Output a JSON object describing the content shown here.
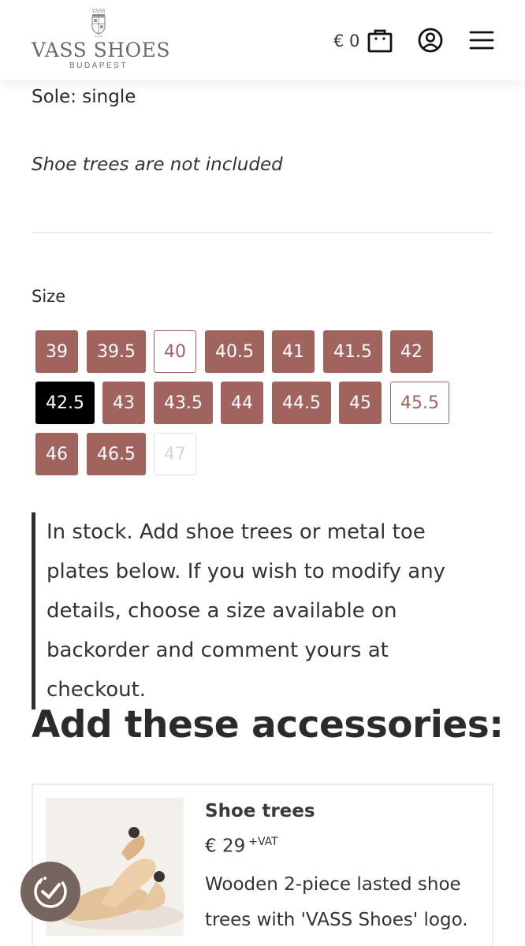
{
  "header": {
    "brand": "VASS SHOES",
    "brand_city": "BUDAPEST",
    "crest_text": "VASS",
    "crest_year": "1978",
    "cart_amount": "€ 0",
    "icons": [
      "shopping-bag-icon",
      "account-icon",
      "hamburger-menu-icon"
    ]
  },
  "product": {
    "sole_text": "Sole: single",
    "shoe_trees_note": "Shoe trees are not included",
    "size_label": "Size",
    "sizes": [
      {
        "label": "39",
        "state": "available"
      },
      {
        "label": "39.5",
        "state": "available"
      },
      {
        "label": "40",
        "state": "backorder"
      },
      {
        "label": "40.5",
        "state": "available"
      },
      {
        "label": "41",
        "state": "available"
      },
      {
        "label": "41.5",
        "state": "available"
      },
      {
        "label": "42",
        "state": "available"
      },
      {
        "label": "42.5",
        "state": "selected"
      },
      {
        "label": "43",
        "state": "available"
      },
      {
        "label": "43.5",
        "state": "available"
      },
      {
        "label": "44",
        "state": "available"
      },
      {
        "label": "44.5",
        "state": "available"
      },
      {
        "label": "45",
        "state": "available"
      },
      {
        "label": "45.5",
        "state": "backorder"
      },
      {
        "label": "46",
        "state": "available"
      },
      {
        "label": "46.5",
        "state": "available"
      },
      {
        "label": "47",
        "state": "unavailable"
      }
    ],
    "stock_note": "In stock. Add shoe trees or metal toe plates below. If you wish to modify any details, choose a size available on backorder and comment yours at checkout."
  },
  "accessories": {
    "title": "Add these accessories:",
    "items": [
      {
        "name": "Shoe trees",
        "price": "€ 29",
        "vat": "+VAT",
        "description": "Wooden 2-piece lasted shoe trees with 'VASS Shoes' logo."
      }
    ]
  },
  "colors": {
    "accent": "#a1635e",
    "selected": "#000000",
    "badge": "#75655e"
  }
}
